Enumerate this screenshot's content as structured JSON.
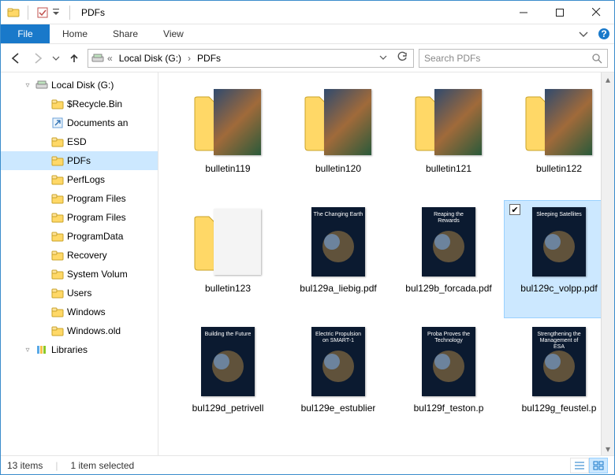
{
  "window": {
    "title": "PDFs"
  },
  "ribbon": {
    "file": "File",
    "tabs": [
      "Home",
      "Share",
      "View"
    ]
  },
  "address": {
    "crumbs": [
      "Local Disk (G:)",
      "PDFs"
    ],
    "search_placeholder": "Search PDFs"
  },
  "navpane": {
    "root": {
      "label": "Local Disk (G:)",
      "icon": "drive",
      "expanded": true
    },
    "children": [
      {
        "label": "$Recycle.Bin",
        "icon": "folder"
      },
      {
        "label": "Documents an",
        "icon": "shortcut"
      },
      {
        "label": "ESD",
        "icon": "folder"
      },
      {
        "label": "PDFs",
        "icon": "folder",
        "selected": true
      },
      {
        "label": "PerfLogs",
        "icon": "folder"
      },
      {
        "label": "Program Files",
        "icon": "folder"
      },
      {
        "label": "Program Files",
        "icon": "folder"
      },
      {
        "label": "ProgramData",
        "icon": "folder"
      },
      {
        "label": "Recovery",
        "icon": "folder"
      },
      {
        "label": "System Volum",
        "icon": "folder"
      },
      {
        "label": "Users",
        "icon": "folder"
      },
      {
        "label": "Windows",
        "icon": "folder"
      },
      {
        "label": "Windows.old",
        "icon": "folder"
      }
    ],
    "after": {
      "label": "Libraries",
      "icon": "libraries",
      "expanded": true
    }
  },
  "files": [
    {
      "name": "bulletin119",
      "type": "folder-stack",
      "caption": "",
      "theme": "photo"
    },
    {
      "name": "bulletin120",
      "type": "folder-stack",
      "caption": "",
      "theme": "photo"
    },
    {
      "name": "bulletin121",
      "type": "folder-stack",
      "caption": "",
      "theme": "photo"
    },
    {
      "name": "bulletin122",
      "type": "folder-stack",
      "caption": "",
      "theme": "photo"
    },
    {
      "name": "bulletin123",
      "type": "folder-stack",
      "caption": "",
      "theme": "light"
    },
    {
      "name": "bul129a_liebig.pdf",
      "type": "pdf",
      "caption": "The Changing Earth",
      "theme": "dark"
    },
    {
      "name": "bul129b_forcada.pdf",
      "type": "pdf",
      "caption": "Reaping the Rewards",
      "theme": "dark"
    },
    {
      "name": "bul129c_volpp.pdf",
      "type": "pdf",
      "caption": "Sleeping Satellites",
      "theme": "dark",
      "selected": true
    },
    {
      "name": "bul129d_petrivell",
      "type": "pdf",
      "caption": "Building the Future",
      "theme": "dark"
    },
    {
      "name": "bul129e_estublier",
      "type": "pdf",
      "caption": "Electric Propulsion on SMART-1",
      "theme": "dark"
    },
    {
      "name": "bul129f_teston.p",
      "type": "pdf",
      "caption": "Proba Proves the Technology",
      "theme": "dark"
    },
    {
      "name": "bul129g_feustel.p",
      "type": "pdf",
      "caption": "Strengthening the Management of ESA",
      "theme": "dark"
    }
  ],
  "status": {
    "count": "13 items",
    "selection": "1 item selected"
  }
}
